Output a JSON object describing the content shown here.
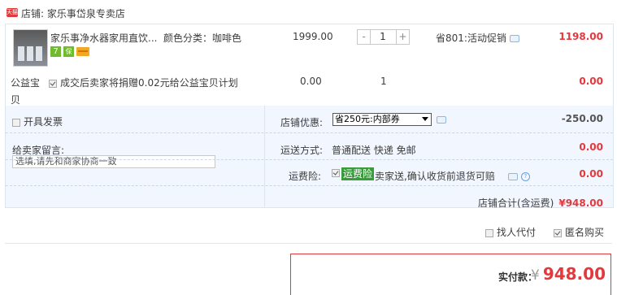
{
  "shop": {
    "badge": "天猫",
    "label": "店铺: 家乐事岱泉专卖店"
  },
  "item": {
    "title": "家乐事净水器家用直饮...",
    "sku": "颜色分类：咖啡色",
    "unit_price": "1999.00",
    "quantity": "1",
    "stepper_minus": "-",
    "stepper_plus": "+",
    "promotion": "省801:活动促销",
    "total": "1198.00",
    "service_icons": [
      "7",
      "保",
      "card"
    ]
  },
  "charity": {
    "label": "公益宝贝",
    "description": "成交后卖家将捐赠0.02元给公益宝贝计划",
    "price": "0.00",
    "quantity": "1",
    "total": "0.00"
  },
  "invoice": {
    "label": "开具发票"
  },
  "message": {
    "label": "给卖家留言:",
    "placeholder": "选填,请先和商家协商一致"
  },
  "shop_discount": {
    "label": "店铺优惠:",
    "selected": "省250元:内部券",
    "value": "-250.00"
  },
  "delivery": {
    "label": "运送方式:",
    "value": "普通配送 快递 免邮",
    "cost": "0.00"
  },
  "insurance": {
    "label": "运费险:",
    "tag": "运费险",
    "description": "卖家送,确认收货前退货可赔",
    "cost": "0.00"
  },
  "shop_total": {
    "label": "店铺合计(含运费)",
    "amount": "¥948.00"
  },
  "options": {
    "proxy_pay": "找人代付",
    "anonymous": "匿名购买"
  },
  "payment": {
    "label": "实付款：",
    "currency": "¥",
    "amount": "948.00"
  },
  "colors": {
    "accent_red": "#e4393c",
    "panel_bg": "#f2f7ff",
    "insurance_green": "#3a9b3a"
  }
}
